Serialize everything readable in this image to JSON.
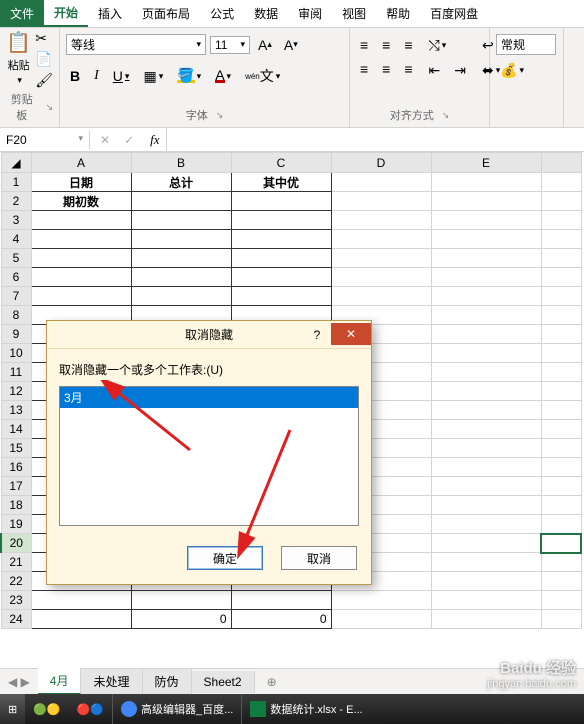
{
  "tabs": {
    "file": "文件",
    "home": "开始",
    "insert": "插入",
    "layout": "页面布局",
    "formulas": "公式",
    "data": "数据",
    "review": "审阅",
    "view": "视图",
    "help": "帮助",
    "baidu": "百度网盘"
  },
  "ribbon": {
    "clipboard": {
      "paste": "粘贴",
      "label": "剪贴板"
    },
    "font": {
      "name": "等线",
      "size": "11",
      "label": "字体"
    },
    "align": {
      "label": "对齐方式"
    },
    "number": {
      "format": "常规"
    }
  },
  "namebox": "F20",
  "grid": {
    "cols": [
      "A",
      "B",
      "C",
      "D",
      "E"
    ],
    "rows": [
      "1",
      "2",
      "3",
      "4",
      "5",
      "6",
      "7",
      "8",
      "9",
      "10",
      "11",
      "12",
      "13",
      "14",
      "15",
      "16",
      "17",
      "18",
      "19",
      "20",
      "21",
      "22",
      "23",
      "24"
    ],
    "header": {
      "A": "日期",
      "B": "总计",
      "C": "其中优"
    },
    "row2": {
      "A": "期初数"
    },
    "row24": {
      "B": "0",
      "C": "0"
    }
  },
  "sheets": {
    "s1": "4月",
    "s2": "未处理",
    "s3": "防伪",
    "s4": "Sheet2"
  },
  "dialog": {
    "title": "取消隐藏",
    "prompt": "取消隐藏一个或多个工作表:(U)",
    "item": "3月",
    "ok": "确定",
    "cancel": "取消"
  },
  "taskbar": {
    "app1": "高级编辑器_百度...",
    "app2": "数据统计.xlsx - E..."
  },
  "watermark": {
    "brand": "Baidu 经验",
    "url": "jingyan.baidu.com"
  }
}
